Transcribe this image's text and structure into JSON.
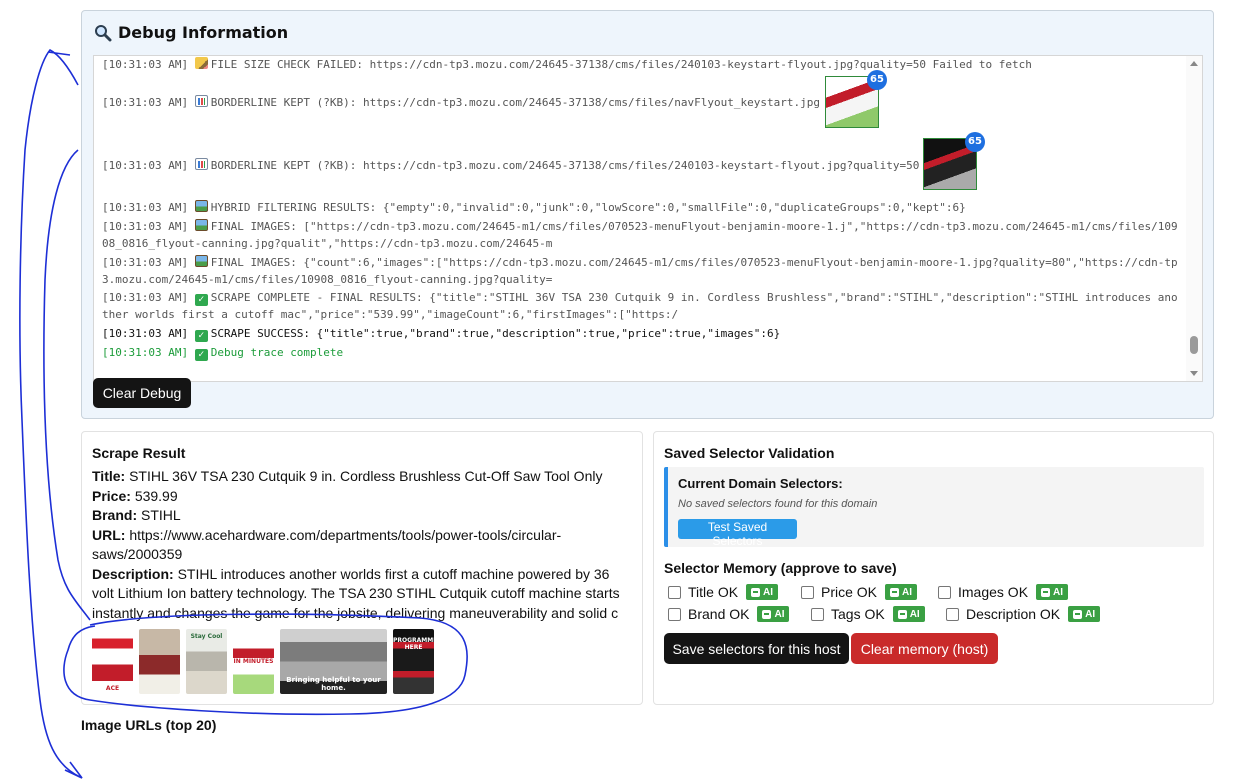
{
  "debug": {
    "title": "Debug Information",
    "lines": [
      {
        "time": "[10:31:03 AM]",
        "text": "FILE SIZE CHECK FAILED: https://cdn-tp3.mozu.com/24645-37138/cms/files/240103-keystart-flyout.jpg?quality=50 Failed to fetch"
      },
      {
        "time": "[10:31:03 AM]",
        "text": "BORDERLINE KEPT (?KB): https://cdn-tp3.mozu.com/24645-37138/cms/files/navFlyout_keystart.jpg",
        "badge": "65"
      },
      {
        "time": "[10:31:03 AM]",
        "text": "BORDERLINE KEPT (?KB): https://cdn-tp3.mozu.com/24645-37138/cms/files/240103-keystart-flyout.jpg?quality=50",
        "badge": "65"
      },
      {
        "time": "[10:31:03 AM]",
        "text": "HYBRID FILTERING RESULTS: {\"empty\":0,\"invalid\":0,\"junk\":0,\"lowScore\":0,\"smallFile\":0,\"duplicateGroups\":0,\"kept\":6}"
      },
      {
        "time": "[10:31:03 AM]",
        "text": "FINAL IMAGES: [\"https://cdn-tp3.mozu.com/24645-m1/cms/files/070523-menuFlyout-benjamin-moore-1.j\",\"https://cdn-tp3.mozu.com/24645-m1/cms/files/10908_0816_flyout-canning.jpg?qualit\",\"https://cdn-tp3.mozu.com/24645-m"
      },
      {
        "time": "[10:31:03 AM]",
        "text": "FINAL IMAGES: {\"count\":6,\"images\":[\"https://cdn-tp3.mozu.com/24645-m1/cms/files/070523-menuFlyout-benjamin-moore-1.jpg?quality=80\",\"https://cdn-tp3.mozu.com/24645-m1/cms/files/10908_0816_flyout-canning.jpg?quality="
      },
      {
        "time": "[10:31:03 AM]",
        "text": "SCRAPE COMPLETE - FINAL RESULTS: {\"title\":\"STIHL 36V TSA 230 Cutquik 9 in. Cordless Brushless\",\"brand\":\"STIHL\",\"description\":\"STIHL introduces another worlds first a cutoff mac\",\"price\":\"539.99\",\"imageCount\":6,\"firstImages\":[\"https:/"
      },
      {
        "time": "[10:31:03 AM]",
        "text": "SCRAPE SUCCESS: {\"title\":true,\"brand\":true,\"description\":true,\"price\":true,\"images\":6}"
      },
      {
        "time": "[10:31:03 AM]",
        "text": "Debug trace complete"
      }
    ],
    "clear_label": "Clear Debug"
  },
  "result": {
    "title": "Scrape Result",
    "title_label": "Title:",
    "title_value": "STIHL 36V TSA 230 Cutquik 9 in. Cordless Brushless Cut-Off Saw Tool Only",
    "price_label": "Price:",
    "price_value": "539.99",
    "brand_label": "Brand:",
    "brand_value": "STIHL",
    "url_label": "URL:",
    "url_value": "https://www.acehardware.com/departments/tools/power-tools/circular-saws/2000359",
    "desc_label": "Description:",
    "desc_value": "STIHL introduces another worlds first a cutoff machine powered by 36 volt Lithium Ion battery technology. The TSA 230 STIHL Cutquik cutoff machine starts instantly and changes the game for the jobsite, delivering maneuverability and solid c",
    "thumb_captions": [
      "ACE",
      "",
      "Stay Cool",
      "PROGRAMMED IN MINUTES",
      "Bringing helpful to your home.",
      "PROGRAMMED HERE"
    ]
  },
  "validation": {
    "title": "Saved Selector Validation",
    "domain_label": "Current Domain Selectors:",
    "domain_note": "No saved selectors found for this domain",
    "test_label": "Test Saved Selectors",
    "memory_title": "Selector Memory (approve to save)",
    "checks": [
      "Title OK",
      "Price OK",
      "Images OK",
      "Brand OK",
      "Tags OK",
      "Description OK"
    ],
    "ai_label": "AI",
    "save_label": "Save selectors for this host",
    "clear_label": "Clear memory (host)"
  },
  "urls_title": "Image URLs (top 20)"
}
